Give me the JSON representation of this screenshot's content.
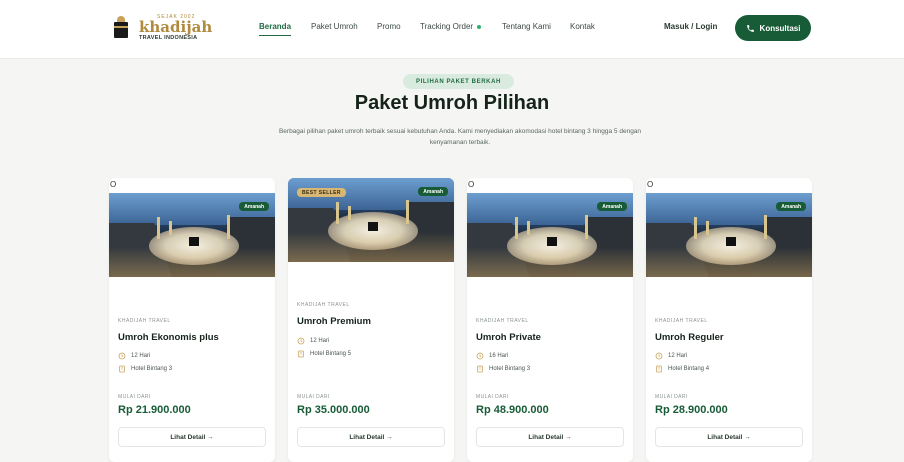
{
  "nav": {
    "logo": {
      "top": "SEJAK 2002",
      "name": "khadijah",
      "sub": "TRAVEL INDONESIA"
    },
    "items": [
      {
        "label": "Beranda",
        "active": true
      },
      {
        "label": "Paket Umroh",
        "active": false
      },
      {
        "label": "Promo",
        "active": false
      },
      {
        "label": "Tracking Order",
        "active": false,
        "indicator": "green-dot"
      },
      {
        "label": "Tentang Kami",
        "active": false
      },
      {
        "label": "Kontak",
        "active": false
      }
    ],
    "login_label": "Masuk / Login",
    "cta_label": "Konsultasi",
    "cta_icon": "phone-icon"
  },
  "hero": {
    "eyebrow": "PILIHAN PAKET BERKAH",
    "title": "Paket Umroh Pilihan",
    "description": "Berbagai pilihan paket umroh terbaik sesuai kebutuhan Anda. Kami menyediakan akomodasi hotel bintang 3 hingga 5 dengan kenyamanan terbaik."
  },
  "cards": [
    {
      "ring": "O",
      "badge": "Amanah",
      "highlight": "",
      "agency": "KHADIJAH TRAVEL",
      "name": "Umroh Ekonomis plus",
      "duration": "12 Hari",
      "hotel": "Hotel Bintang 3",
      "from_label": "MULAI DARI",
      "price": "Rp 21.900.000",
      "button": "Lihat Detail →"
    },
    {
      "ring": "",
      "badge": "Amanah",
      "highlight": "BEST SELLER",
      "agency": "KHADIJAH TRAVEL",
      "name": "Umroh Premium",
      "duration": "12 Hari",
      "hotel": "Hotel Bintang 5",
      "from_label": "MULAI DARI",
      "price": "Rp 35.000.000",
      "button": "Lihat Detail →"
    },
    {
      "ring": "O",
      "badge": "Amanah",
      "highlight": "",
      "agency": "KHADIJAH TRAVEL",
      "name": "Umroh Private",
      "duration": "16 Hari",
      "hotel": "Hotel Bintang 3",
      "from_label": "MULAI DARI",
      "price": "Rp 48.900.000",
      "button": "Lihat Detail →"
    },
    {
      "ring": "O",
      "badge": "Amanah",
      "highlight": "",
      "agency": "KHADIJAH TRAVEL",
      "name": "Umroh Reguler",
      "duration": "12 Hari",
      "hotel": "Hotel Bintang 4",
      "from_label": "MULAI DARI",
      "price": "Rp 28.900.000",
      "button": "Lihat Detail →"
    }
  ],
  "colors": {
    "brand_green": "#175c36",
    "gold": "#b08a3e",
    "page_bg": "#f5f6f4"
  }
}
